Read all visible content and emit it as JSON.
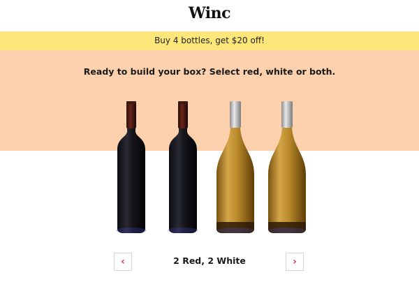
{
  "brand": {
    "logo": "Winc"
  },
  "promo": {
    "text": "Buy 4 bottles, get $20 off!"
  },
  "main": {
    "headline": "Ready to build your box? Select red, white or both.",
    "selection_label": "2 Red, 2 White",
    "bottles": [
      {
        "kind": "red",
        "icon": "red-wine-bottle"
      },
      {
        "kind": "red",
        "icon": "red-wine-bottle"
      },
      {
        "kind": "white",
        "icon": "white-wine-bottle"
      },
      {
        "kind": "white",
        "icon": "white-wine-bottle"
      }
    ],
    "prev_icon": "chevron-left-icon",
    "next_icon": "chevron-right-icon"
  },
  "colors": {
    "promo_bar": "#fde77a",
    "peach_background": "#fdd1ad",
    "arrow_accent": "#d6324b"
  }
}
